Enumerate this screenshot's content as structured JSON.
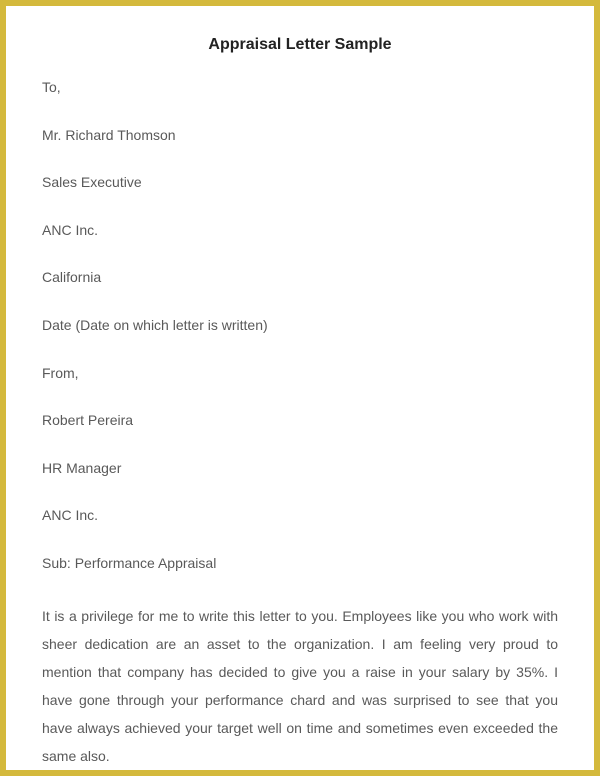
{
  "title": "Appraisal Letter Sample",
  "to_label": "To,",
  "recipient_name": "Mr. Richard Thomson",
  "recipient_title": "Sales Executive",
  "recipient_company": "ANC Inc.",
  "recipient_location": "California",
  "date_line": "Date (Date on which letter is written)",
  "from_label": "From,",
  "sender_name": "Robert Pereira",
  "sender_title": "HR Manager",
  "sender_company": "ANC Inc.",
  "subject": "Sub: Performance Appraisal",
  "body": "It is a privilege for me to write this letter to you. Employees like you who work with sheer dedication are an asset to the organization. I am feeling very proud to mention that company has decided to give you a raise in your salary by 35%. I have gone through your performance chard and was surprised to see that you have always achieved your target well on time and sometimes even exceeded the same also."
}
